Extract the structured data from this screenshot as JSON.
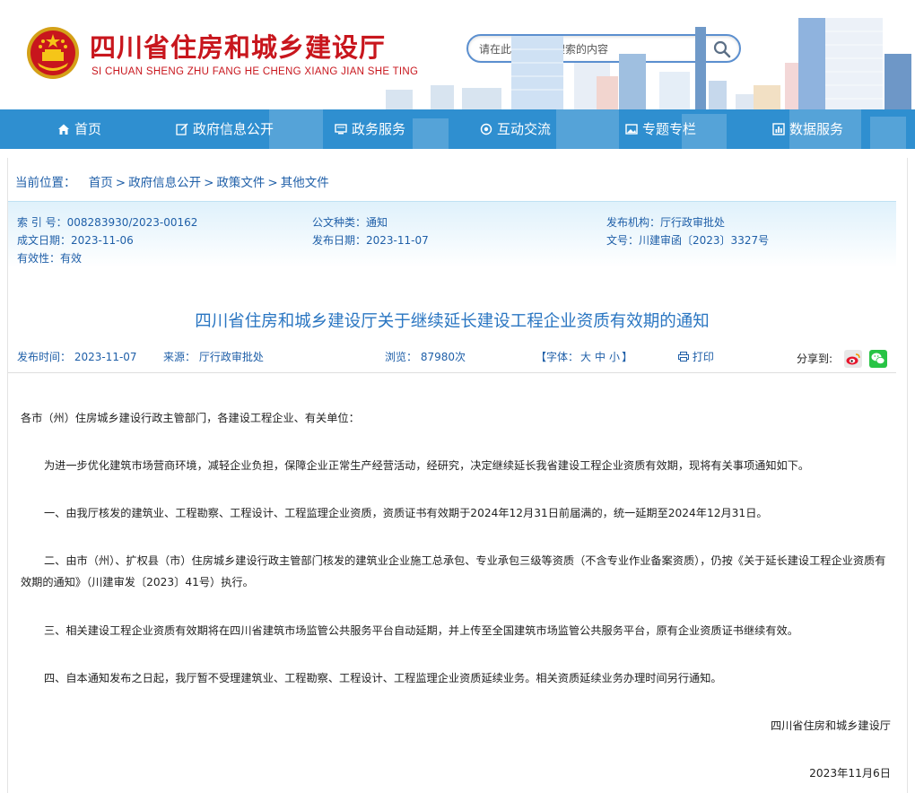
{
  "header": {
    "title": "四川省住房和城乡建设厅",
    "pinyin": "SI CHUAN SHENG ZHU FANG HE CHENG XIANG JIAN SHE TING",
    "search_placeholder": "请在此输入您要搜索的内容",
    "brand_color": "#c8161d"
  },
  "nav": {
    "color": "#2f8fd0",
    "items": [
      {
        "label": "首页",
        "icon": "home-icon"
      },
      {
        "label": "政府信息公开",
        "icon": "edit-icon"
      },
      {
        "label": "政务服务",
        "icon": "monitor-icon"
      },
      {
        "label": "互动交流",
        "icon": "interaction-icon"
      },
      {
        "label": "专题专栏",
        "icon": "image-icon"
      },
      {
        "label": "数据服务",
        "icon": "chart-icon"
      }
    ]
  },
  "breadcrumb": {
    "label": "当前位置：",
    "items": [
      "首页",
      "政府信息公开",
      "政策文件",
      "其他文件"
    ],
    "separator": ">"
  },
  "meta": {
    "index_no": {
      "k": "索 引 号：",
      "v": "008283930/2023-00162"
    },
    "doc_type": {
      "k": "公文种类：",
      "v": "通知"
    },
    "issuer": {
      "k": "发布机构：",
      "v": "厅行政审批处"
    },
    "created": {
      "k": "成文日期：",
      "v": "2023-11-06"
    },
    "published": {
      "k": "发布日期：",
      "v": "2023-11-07"
    },
    "doc_no": {
      "k": "文号：",
      "v": "川建审函〔2023〕3327号"
    },
    "validity": {
      "k": "有效性：",
      "v": "有效"
    }
  },
  "article": {
    "title": "四川省住房和城乡建设厅关于继续延长建设工程企业资质有效期的通知",
    "publish_time": "发布时间：  2023-11-07",
    "source": "来源：  厅行政审批处",
    "views": "浏览：  87980次",
    "font_label": "【字体：",
    "font_large": "大",
    "font_medium": "中",
    "font_small": "小",
    "font_close": "】",
    "print": "打印",
    "share": "分享到:",
    "salutation": "各市（州）住房城乡建设行政主管部门，各建设工程企业、有关单位：",
    "p1": "为进一步优化建筑市场营商环境，减轻企业负担，保障企业正常生产经营活动，经研究，决定继续延长我省建设工程企业资质有效期，现将有关事项通知如下。",
    "p2": "一、由我厅核发的建筑业、工程勘察、工程设计、工程监理企业资质，资质证书有效期于2024年12月31日前届满的，统一延期至2024年12月31日。",
    "p3": "二、由市（州）、扩权县（市）住房城乡建设行政主管部门核发的建筑业企业施工总承包、专业承包三级等资质（不含专业作业备案资质），仍按《关于延长建设工程企业资质有效期的通知》（川建审发〔2023〕41号）执行。",
    "p4": "三、相关建设工程企业资质有效期将在四川省建筑市场监管公共服务平台自动延期，并上传至全国建筑市场监管公共服务平台，原有企业资质证书继续有效。",
    "p5": "四、自本通知发布之日起，我厅暂不受理建筑业、工程勘察、工程设计、工程监理企业资质延续业务。相关资质延续业务办理时间另行通知。",
    "signature": "四川省住房和城乡建设厅",
    "date": "2023年11月6日"
  }
}
